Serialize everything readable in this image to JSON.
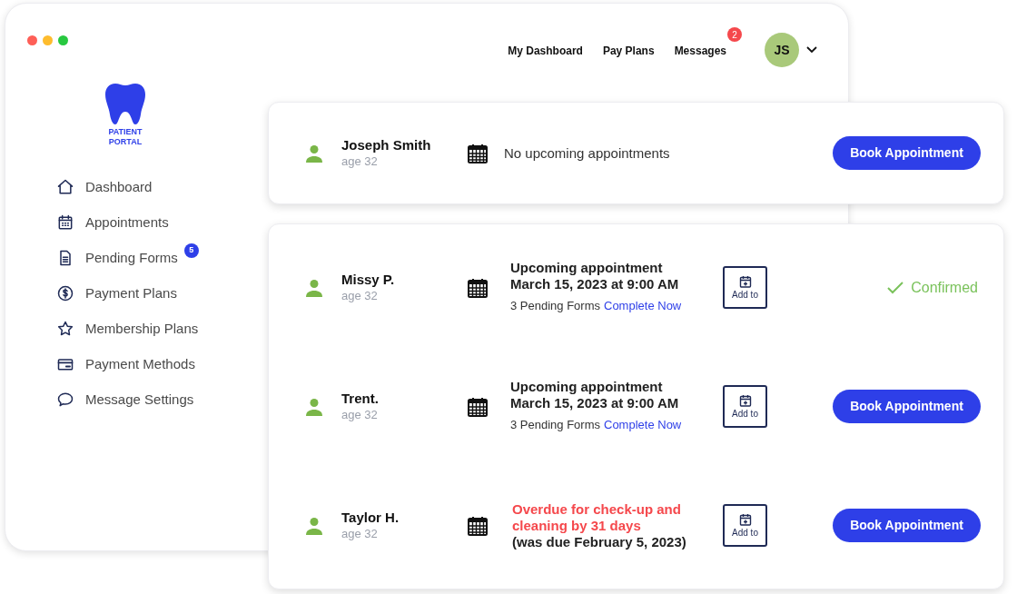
{
  "logo": {
    "lines": [
      "PATIENT",
      "PORTAL"
    ]
  },
  "top_nav": [
    {
      "label": "My Dashboard"
    },
    {
      "label": "Pay Plans"
    },
    {
      "label": "Messages",
      "badge": "2"
    }
  ],
  "user": {
    "initials": "JS"
  },
  "sidebar": {
    "items": [
      {
        "label": "Dashboard"
      },
      {
        "label": "Appointments"
      },
      {
        "label": "Pending Forms",
        "badge": "5"
      },
      {
        "label": "Payment Plans"
      },
      {
        "label": "Membership Plans"
      },
      {
        "label": "Payment Methods"
      },
      {
        "label": "Message Settings"
      }
    ]
  },
  "cards": [
    {
      "patients": [
        {
          "name": "Joseph Smith",
          "age": "age 32",
          "appointment": {
            "kind": "none",
            "text": "No upcoming appointments"
          },
          "action": {
            "kind": "button",
            "label": "Book Appointment"
          }
        }
      ]
    },
    {
      "patients": [
        {
          "name": "Missy P.",
          "age": "age 32",
          "appointment": {
            "kind": "upcoming",
            "title": "Upcoming appointment",
            "datetime": "March 15, 2023 at 9:00 AM",
            "forms": "3 Pending Forms",
            "link": "Complete Now",
            "add_to": "Add to"
          },
          "action": {
            "kind": "status",
            "label": "Confirmed"
          }
        },
        {
          "name": "Trent.",
          "age": "age 32",
          "appointment": {
            "kind": "upcoming",
            "title": "Upcoming appointment",
            "datetime": "March 15, 2023 at 9:00 AM",
            "forms": "3 Pending Forms",
            "link": "Complete Now",
            "add_to": "Add to"
          },
          "action": {
            "kind": "button",
            "label": "Book Appointment"
          }
        },
        {
          "name": "Taylor H.",
          "age": "age 32",
          "appointment": {
            "kind": "overdue",
            "alert": "Overdue for check-up and cleaning by 31 days",
            "note": "(was due February 5, 2023)",
            "add_to": "Add to"
          },
          "action": {
            "kind": "button",
            "label": "Book Appointment"
          }
        }
      ]
    }
  ]
}
